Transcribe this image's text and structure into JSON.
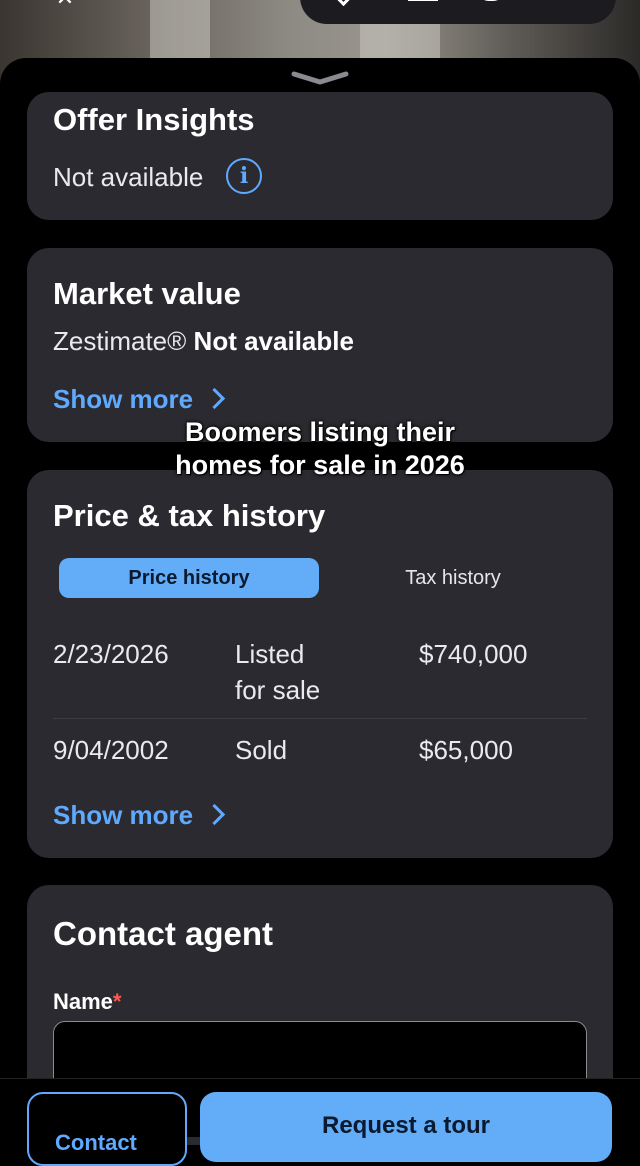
{
  "caption": {
    "line1": "Boomers listing their",
    "line2": "homes for sale in 2026"
  },
  "offer_insights": {
    "title": "Offer Insights",
    "status": "Not available"
  },
  "market_value": {
    "title": "Market value",
    "zestimate_label": "Zestimate®",
    "zestimate_value": "Not available",
    "show_more": "Show more"
  },
  "price_tax_history": {
    "title": "Price & tax history",
    "tabs": [
      "Price history",
      "Tax history"
    ],
    "active_tab": "Price history",
    "rows": [
      {
        "date": "2/23/2026",
        "event_line1": "Listed",
        "event_line2": "for sale",
        "price": "$740,000"
      },
      {
        "date": "9/04/2002",
        "event_line1": "Sold",
        "event_line2": "",
        "price": "$65,000"
      }
    ],
    "show_more": "Show more"
  },
  "contact_agent": {
    "title": "Contact agent",
    "name_label": "Name",
    "required_mark": "*"
  },
  "bottom_actions": {
    "secondary_label": "Contact",
    "primary_label": "Request a tour"
  },
  "colors": {
    "accent": "#5fa9ff",
    "card_bg": "#2b2a30",
    "page_bg": "#000000",
    "primary_button": "#63acf7"
  }
}
